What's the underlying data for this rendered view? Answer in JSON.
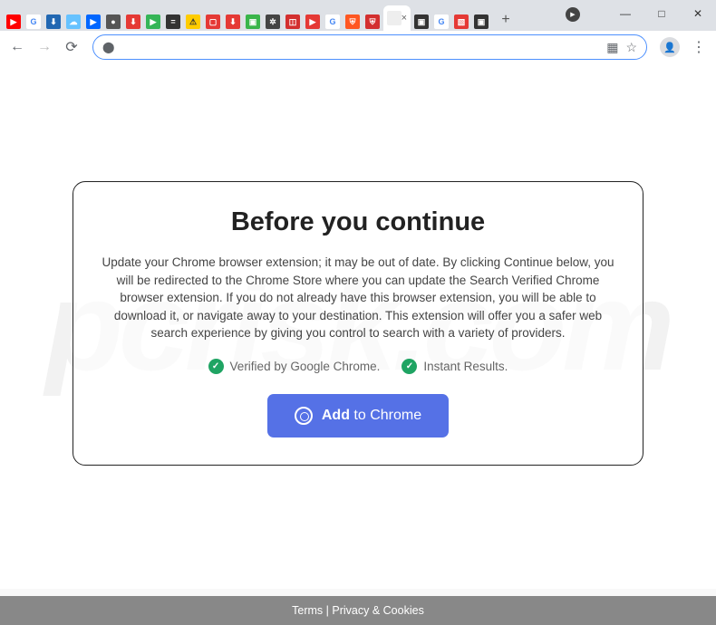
{
  "window": {
    "minimize": "—",
    "maximize": "□",
    "close": "✕"
  },
  "tabs": {
    "new_tab": "+",
    "active_close": "×",
    "icons": [
      {
        "bg": "#ff0000",
        "txt": "▶"
      },
      {
        "bg": "#fff",
        "txt": "G",
        "color": "#4285f4"
      },
      {
        "bg": "#2167b2",
        "txt": "⬇"
      },
      {
        "bg": "#66c2ff",
        "txt": "☁"
      },
      {
        "bg": "#0066ff",
        "txt": "▶"
      },
      {
        "bg": "#555",
        "txt": "●"
      },
      {
        "bg": "#e53935",
        "txt": "⬇"
      },
      {
        "bg": "#35b557",
        "txt": "▶"
      },
      {
        "bg": "#333",
        "txt": "="
      },
      {
        "bg": "#ffcc00",
        "txt": "⚠",
        "color": "#333"
      },
      {
        "bg": "#e53935",
        "txt": "▢"
      },
      {
        "bg": "#e53935",
        "txt": "⬇"
      },
      {
        "bg": "#3ab54a",
        "txt": "▣"
      },
      {
        "bg": "#444",
        "txt": "✲"
      },
      {
        "bg": "#d32f2f",
        "txt": "◫"
      },
      {
        "bg": "#e53935",
        "txt": "▶"
      },
      {
        "bg": "#fff",
        "txt": "G",
        "color": "#4285f4"
      },
      {
        "bg": "#ff5722",
        "txt": "⛨"
      },
      {
        "bg": "#d32f2f",
        "txt": "⛨"
      }
    ],
    "right_icons": [
      {
        "bg": "#333",
        "txt": "▣"
      },
      {
        "bg": "#fff",
        "txt": "G",
        "color": "#4285f4"
      },
      {
        "bg": "#e53935",
        "txt": "▧"
      },
      {
        "bg": "#333",
        "txt": "▣"
      }
    ]
  },
  "toolbar": {
    "back": "←",
    "forward": "→",
    "reload": "⟳",
    "lock": "🔒",
    "qr": "▦",
    "star": "☆",
    "menu": "⋮"
  },
  "dialog": {
    "title": "Before you continue",
    "body": "Update your Chrome browser extension; it may be out of date. By clicking Continue below, you will be redirected to the Chrome Store where you can update the Search Verified Chrome browser extension. If you do not already have this browser extension, you will be able to download it, or navigate away to your destination. This extension will offer you a safer web search experience by giving you control to search with a variety of providers.",
    "badge1": "Verified by Google Chrome.",
    "badge2": "Instant Results.",
    "cta_strong": "Add",
    "cta_rest": " to Chrome"
  },
  "footer": {
    "terms": "Terms",
    "sep": " | ",
    "privacy": "Privacy & Cookies"
  },
  "watermark": "pcrisk.com"
}
